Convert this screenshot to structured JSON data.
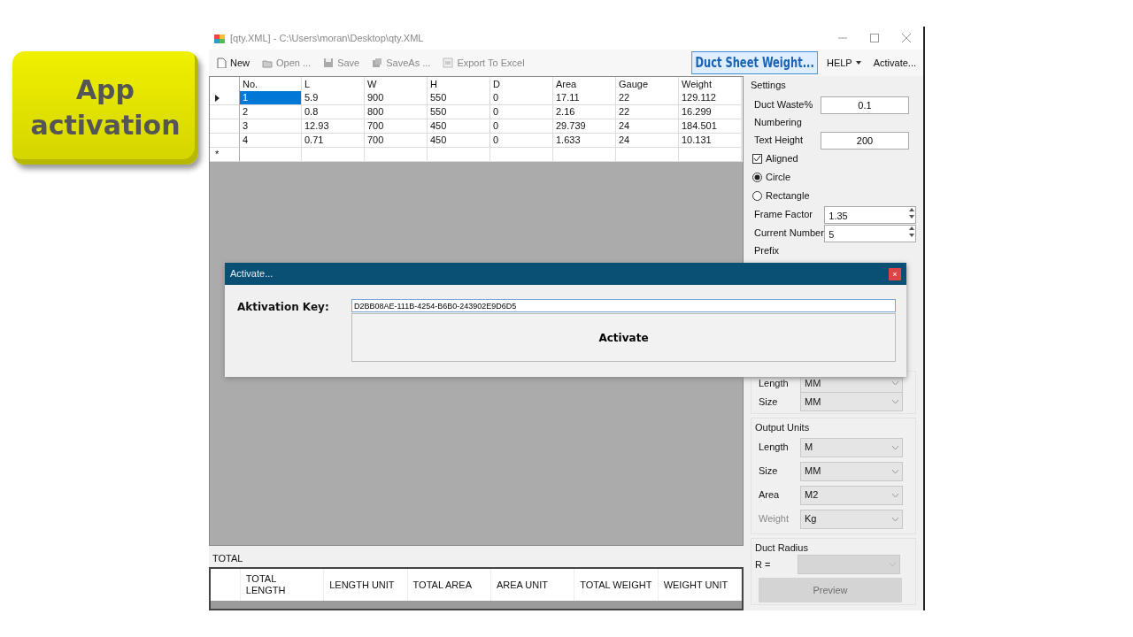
{
  "badge": {
    "text": "App activation"
  },
  "window": {
    "title": "[qty.XML] - C:\\Users\\moran\\Desktop\\qty.XML"
  },
  "toolbar": [
    {
      "label": "New",
      "kind": "new",
      "disabled": false
    },
    {
      "label": "Open ...",
      "kind": "open",
      "disabled": true
    },
    {
      "label": "Save",
      "kind": "save",
      "disabled": true
    },
    {
      "label": "SaveAs ...",
      "kind": "saveas",
      "disabled": true
    },
    {
      "label": "Export To Excel",
      "kind": "export",
      "disabled": true
    }
  ],
  "title_button": {
    "label": "Duct Sheet Weight..."
  },
  "menu": [
    {
      "label": "HELP",
      "has_caret": true
    },
    {
      "label": "Activate...",
      "has_caret": false
    }
  ],
  "grid": {
    "columns": [
      "No.",
      "L",
      "W",
      "H",
      "D",
      "Area",
      "Gauge",
      "Weight"
    ],
    "rows": [
      {
        "selected": true,
        "cells": [
          "1",
          "5.9",
          "900",
          "550",
          "0",
          "17.11",
          "22",
          "129.112"
        ]
      },
      {
        "selected": false,
        "cells": [
          "2",
          "0.8",
          "800",
          "550",
          "0",
          "2.16",
          "22",
          "16.299"
        ]
      },
      {
        "selected": false,
        "cells": [
          "3",
          "12.93",
          "700",
          "450",
          "0",
          "29.739",
          "24",
          "184.501"
        ]
      },
      {
        "selected": false,
        "cells": [
          "4",
          "0.71",
          "700",
          "450",
          "0",
          "1.633",
          "24",
          "10.131"
        ]
      }
    ],
    "new_row_marker": "*"
  },
  "totals": {
    "label": "TOTAL",
    "columns": [
      "TOTAL LENGTH",
      "LENGTH UNIT",
      "TOTAL AREA",
      "AREA UNIT",
      "TOTAL WEIGHT",
      "WEIGHT UNIT"
    ]
  },
  "settings": {
    "title": "Settings",
    "duct_waste": {
      "label": "Duct Waste%",
      "value": "0.1"
    },
    "numbering": "Numbering",
    "text_height": {
      "label": "Text Height",
      "value": "200"
    },
    "aligned": {
      "label": "Aligned",
      "checked": true
    },
    "shapes": [
      {
        "label": "Circle",
        "selected": true
      },
      {
        "label": "Rectangle",
        "selected": false
      }
    ],
    "frame_factor": {
      "label": "Frame Factor",
      "value": "1.35"
    },
    "current_number": {
      "label": "Current Number",
      "value": "5"
    },
    "prefix": "Prefix",
    "input_units": [
      {
        "label": "Length",
        "value": "MM",
        "disabled": false
      },
      {
        "label": "Size",
        "value": "MM",
        "disabled": false
      }
    ],
    "output_units": {
      "title": "Output Units",
      "rows": [
        {
          "label": "Length",
          "value": "M",
          "disabled": false
        },
        {
          "label": "Size",
          "value": "MM",
          "disabled": false
        },
        {
          "label": "Area",
          "value": "M2",
          "disabled": false
        },
        {
          "label": "Weight",
          "value": "Kg",
          "disabled": true
        }
      ]
    },
    "duct_radius": {
      "title": "Duct Radius",
      "label": "R =",
      "disabled": true
    },
    "preview": {
      "label": "Preview",
      "disabled": true
    }
  },
  "dialog": {
    "title": "Activate...",
    "close": "×",
    "key_label": "Aktivation Key:",
    "key_value": "D2BB08AE-111B-4254-B6B0-243902E9D6D5",
    "button": "Activate"
  }
}
